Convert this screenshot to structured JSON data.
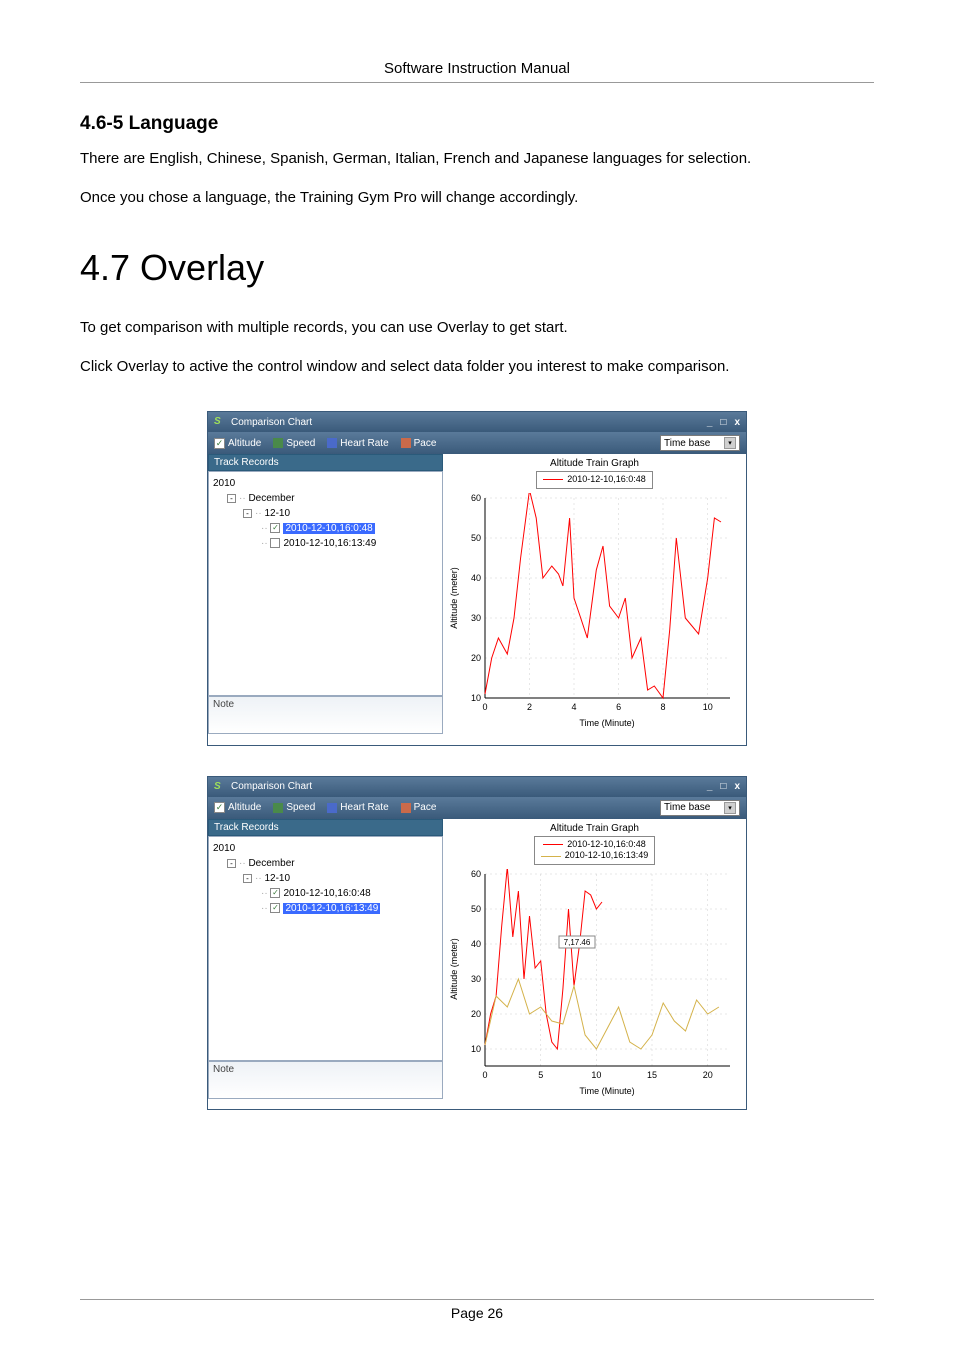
{
  "header": "Software Instruction Manual",
  "section": {
    "heading": "4.6-5 Language",
    "para1": "There are English, Chinese, Spanish, German, Italian, French and Japanese languages for selection.",
    "para2": "Once you chose a language, the Training Gym Pro will change accordingly."
  },
  "chapter": {
    "heading": "4.7 Overlay",
    "para1": "To get comparison with multiple records, you can use Overlay to get start.",
    "para2": "Click Overlay to active the control window and select data folder you interest to make comparison."
  },
  "window": {
    "title": "Comparison Chart",
    "checkboxes": {
      "altitude": "Altitude",
      "speed": "Speed",
      "heartrate": "Heart Rate",
      "pace": "Pace"
    },
    "dropdown": "Time base",
    "panel_title": "Track Records",
    "note_label": "Note",
    "tree": {
      "year": "2010",
      "month": "December",
      "day": "12-10",
      "rec1": "2010-12-10,16:0:48",
      "rec2": "2010-12-10,16:13:49"
    }
  },
  "chart1": {
    "title": "Altitude Train Graph",
    "legend": [
      "2010-12-10,16:0:48"
    ],
    "xlabel": "Time (Minute)",
    "ylabel": "Altitude (meter)"
  },
  "chart2": {
    "title": "Altitude Train Graph",
    "legend": [
      "2010-12-10,16:0:48",
      "2010-12-10,16:13:49"
    ],
    "xlabel": "Time (Minute)",
    "ylabel": "Altitude (meter)",
    "tooltip": "7,17.46"
  },
  "chart_data": [
    {
      "type": "line",
      "title": "Altitude Train Graph",
      "xlabel": "Time (Minute)",
      "ylabel": "Altitude (meter)",
      "xlim": [
        0,
        11
      ],
      "ylim": [
        10,
        65
      ],
      "xticks": [
        0,
        2,
        4,
        6,
        8,
        10
      ],
      "yticks": [
        10,
        20,
        30,
        40,
        50,
        60
      ],
      "series": [
        {
          "name": "2010-12-10,16:0:48",
          "color": "#f00",
          "x": [
            0,
            0.3,
            0.6,
            1,
            1.3,
            1.6,
            2,
            2.3,
            2.6,
            3,
            3.3,
            3.5,
            3.8,
            4,
            4.3,
            4.6,
            5,
            5.3,
            5.6,
            6,
            6.3,
            6.6,
            7,
            7.3,
            7.6,
            8,
            8.3,
            8.6,
            9,
            9.3,
            9.6,
            10,
            10.3,
            10.6
          ],
          "y": [
            11,
            20,
            25,
            21,
            30,
            45,
            62,
            55,
            40,
            43,
            41,
            38,
            55,
            35,
            30,
            25,
            42,
            48,
            33,
            30,
            35,
            20,
            25,
            12,
            13,
            10,
            27,
            50,
            30,
            28,
            26,
            40,
            55,
            54
          ]
        }
      ]
    },
    {
      "type": "line",
      "title": "Altitude Train Graph",
      "xlabel": "Time (Minute)",
      "ylabel": "Altitude (meter)",
      "xlim": [
        0,
        22
      ],
      "ylim": [
        5,
        65
      ],
      "xticks": [
        0,
        5,
        10,
        15,
        20
      ],
      "yticks": [
        10,
        20,
        30,
        40,
        50,
        60
      ],
      "annotations": [
        {
          "x": 7,
          "y": 40,
          "text": "7,17.46"
        }
      ],
      "series": [
        {
          "name": "2010-12-10,16:0:48",
          "color": "#f00",
          "x": [
            0,
            0.5,
            1,
            1.5,
            2,
            2.5,
            3,
            3.5,
            4,
            4.5,
            5,
            5.5,
            6,
            6.5,
            7,
            7.5,
            8,
            8.5,
            9,
            9.5,
            10,
            10.5
          ],
          "y": [
            11,
            20,
            25,
            45,
            62,
            42,
            55,
            35,
            48,
            33,
            35,
            20,
            12,
            10,
            27,
            50,
            28,
            40,
            55,
            54,
            50,
            52
          ]
        },
        {
          "name": "2010-12-10,16:13:49",
          "color": "#d4b24a",
          "x": [
            0,
            1,
            2,
            3,
            4,
            5,
            6,
            7,
            8,
            9,
            10,
            11,
            12,
            13,
            14,
            15,
            16,
            17,
            18,
            19,
            20,
            21
          ],
          "y": [
            11,
            25,
            22,
            30,
            20,
            22,
            18,
            17,
            28,
            14,
            10,
            16,
            22,
            12,
            10,
            14,
            23,
            18,
            15,
            24,
            20,
            22
          ]
        }
      ]
    }
  ],
  "footer": "Page 26"
}
